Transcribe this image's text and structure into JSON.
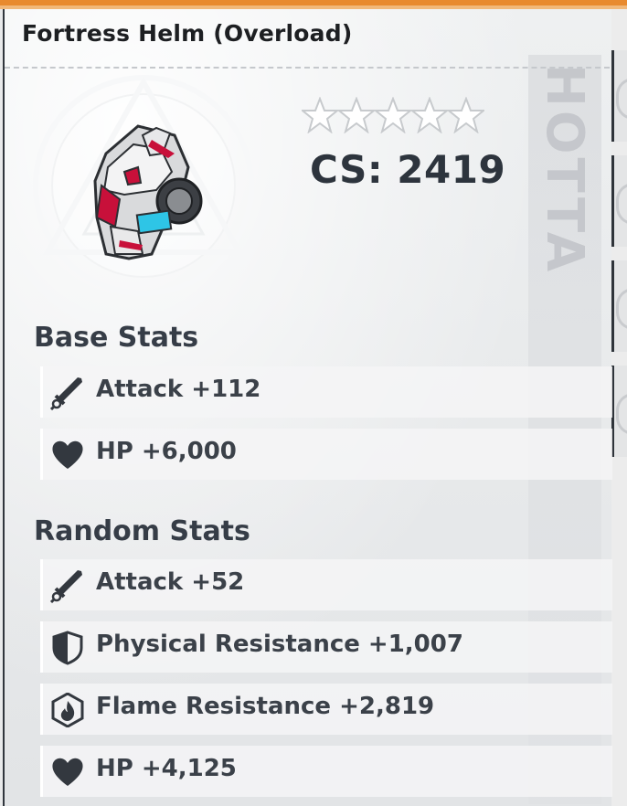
{
  "item": {
    "title": "Fortress Helm (Overload)",
    "rarity_stars": 5,
    "cs_text": "CS: 2419",
    "emblem_text": "HOTTA"
  },
  "base_stats": {
    "heading": "Base Stats",
    "rows": [
      {
        "icon": "sword-icon",
        "text": "Attack +112"
      },
      {
        "icon": "heart-icon",
        "text": "HP +6,000"
      }
    ]
  },
  "random_stats": {
    "heading": "Random Stats",
    "rows": [
      {
        "icon": "sword-icon",
        "text": "Attack +52"
      },
      {
        "icon": "shield-icon",
        "text": "Physical Resistance +1,007"
      },
      {
        "icon": "flame-icon",
        "text": "Flame Resistance +2,819"
      },
      {
        "icon": "heart-icon",
        "text": "HP +4,125"
      }
    ]
  },
  "colors": {
    "accent_orange": "#e88a2e",
    "text_dark": "#3a4049",
    "icon_dark": "#33383f"
  }
}
